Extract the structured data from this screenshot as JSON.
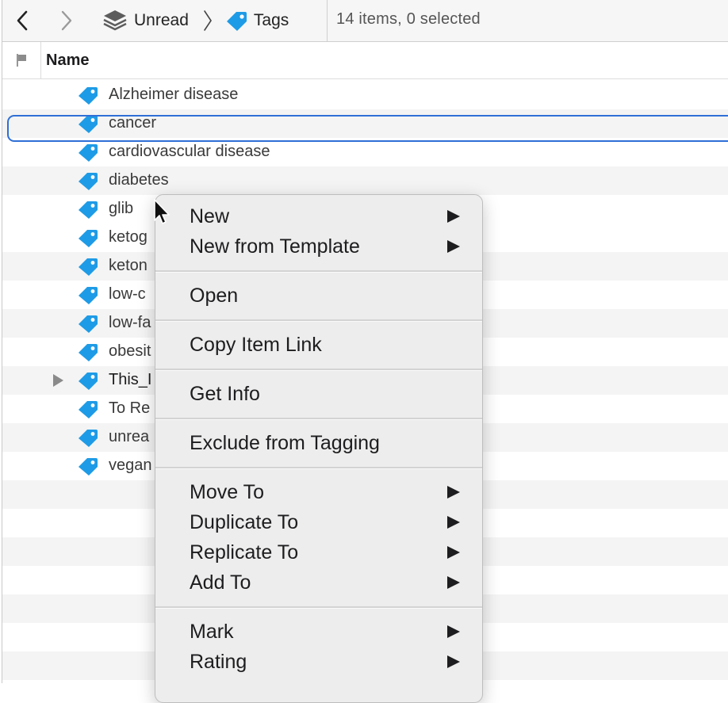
{
  "toolbar": {
    "breadcrumb": [
      {
        "label": "Unread",
        "icon": "layers-icon"
      },
      {
        "label": "Tags",
        "icon": "tag-icon"
      }
    ],
    "status": "14 items, 0 selected"
  },
  "table": {
    "columns": [
      "Name"
    ],
    "rows": [
      {
        "label": "Alzheimer disease"
      },
      {
        "label": "cancer"
      },
      {
        "label": "cardiovascular disease"
      },
      {
        "label": "diabetes"
      },
      {
        "label": "glib"
      },
      {
        "label": "ketog"
      },
      {
        "label": "keton"
      },
      {
        "label": "low-c"
      },
      {
        "label": "low-fa"
      },
      {
        "label": "obesit"
      },
      {
        "label": "This_I"
      },
      {
        "label": "To Re"
      },
      {
        "label": "unrea"
      },
      {
        "label": "vegan"
      }
    ]
  },
  "context_menu": {
    "items": [
      {
        "label": "New",
        "submenu": true
      },
      {
        "label": "New from Template",
        "submenu": true
      },
      {
        "label": "Open",
        "submenu": false
      },
      {
        "label": "Copy Item Link",
        "submenu": false
      },
      {
        "label": "Get Info",
        "submenu": false
      },
      {
        "label": "Exclude from Tagging",
        "submenu": false
      },
      {
        "label": "Move To",
        "submenu": true
      },
      {
        "label": "Duplicate To",
        "submenu": true
      },
      {
        "label": "Replicate To",
        "submenu": true
      },
      {
        "label": "Add To",
        "submenu": true
      },
      {
        "label": "Mark",
        "submenu": true
      },
      {
        "label": "Rating",
        "submenu": true
      }
    ]
  },
  "colors": {
    "tag_blue": "#1e9be6",
    "selection_blue": "#2f6fd6",
    "menu_bg": "#ededed"
  }
}
